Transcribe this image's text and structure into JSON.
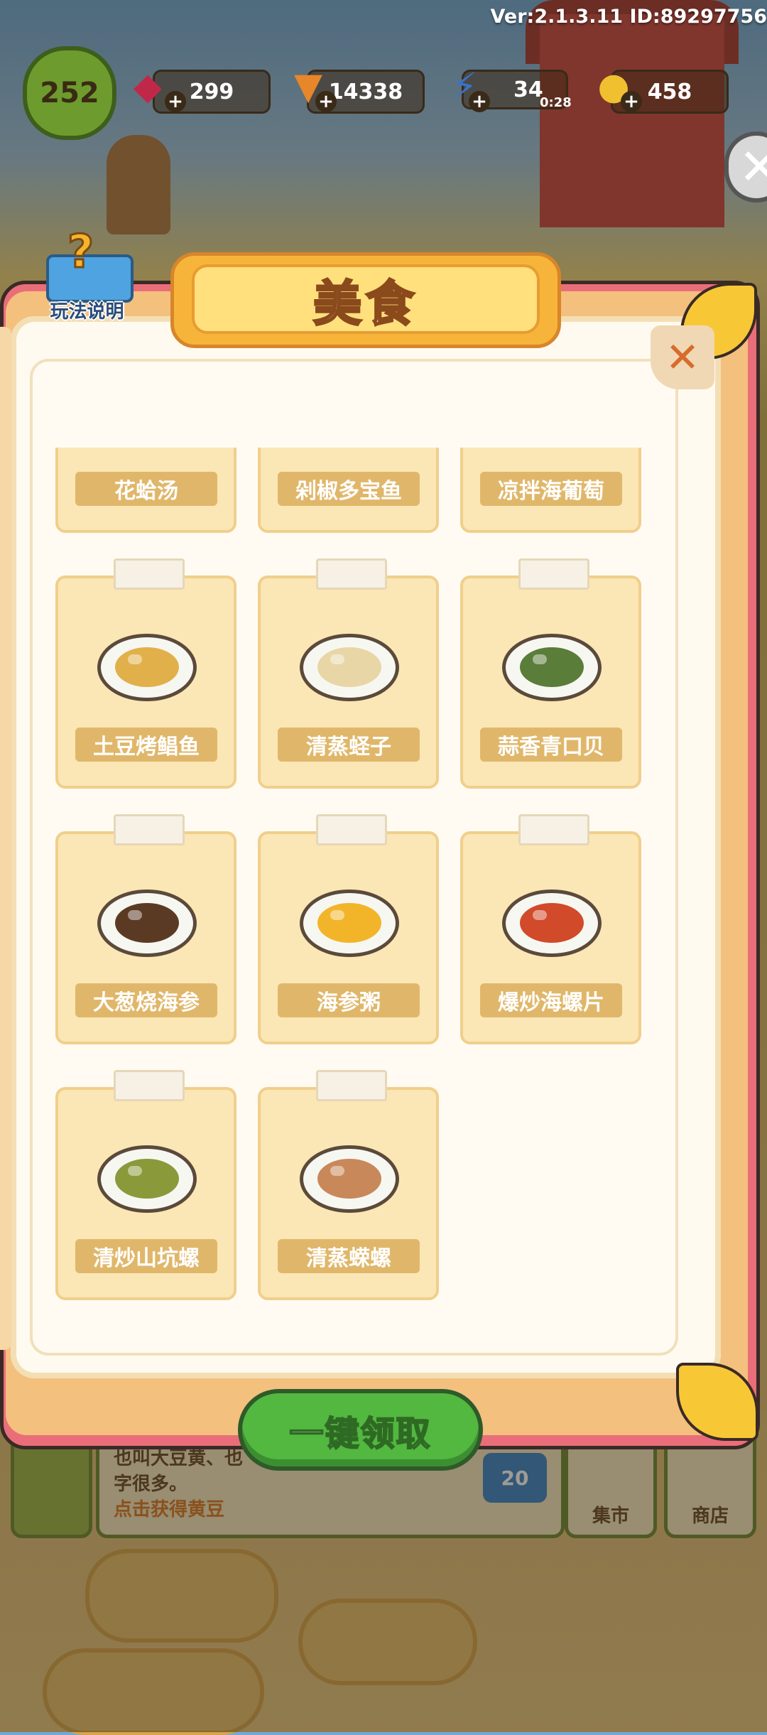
{
  "hud": {
    "version": "Ver:2.1.3.11 ID:89297756",
    "level": "252",
    "gems": "299",
    "carrots": "14338",
    "energy": "34",
    "energy_timer": "0:28",
    "coins": "458"
  },
  "dialog": {
    "title": "美食",
    "help_label": "玩法说明",
    "claim_all_label": "一键领取",
    "foods": [
      {
        "name": "花蛤汤",
        "color": "#d8c07a"
      },
      {
        "name": "剁椒多宝鱼",
        "color": "#d84a2a"
      },
      {
        "name": "凉拌海葡萄",
        "color": "#6db33c"
      },
      {
        "name": "土豆烤鲳鱼",
        "color": "#e2b04a"
      },
      {
        "name": "清蒸蛏子",
        "color": "#e8d6a6"
      },
      {
        "name": "蒜香青口贝",
        "color": "#5a7d3a"
      },
      {
        "name": "大葱烧海参",
        "color": "#5b3a24"
      },
      {
        "name": "海参粥",
        "color": "#f2b52a"
      },
      {
        "name": "爆炒海螺片",
        "color": "#d14a2a"
      },
      {
        "name": "清炒山坑螺",
        "color": "#8a9a3a"
      },
      {
        "name": "清蒸蝾螺",
        "color": "#c8885a"
      }
    ]
  },
  "background_panel": {
    "text_line1": "也叫大豆黄、也",
    "text_line2": "字很多。",
    "text_link": "点击获得黄豆",
    "badge": "20",
    "market_label": "集市",
    "shop_label": "商店"
  }
}
